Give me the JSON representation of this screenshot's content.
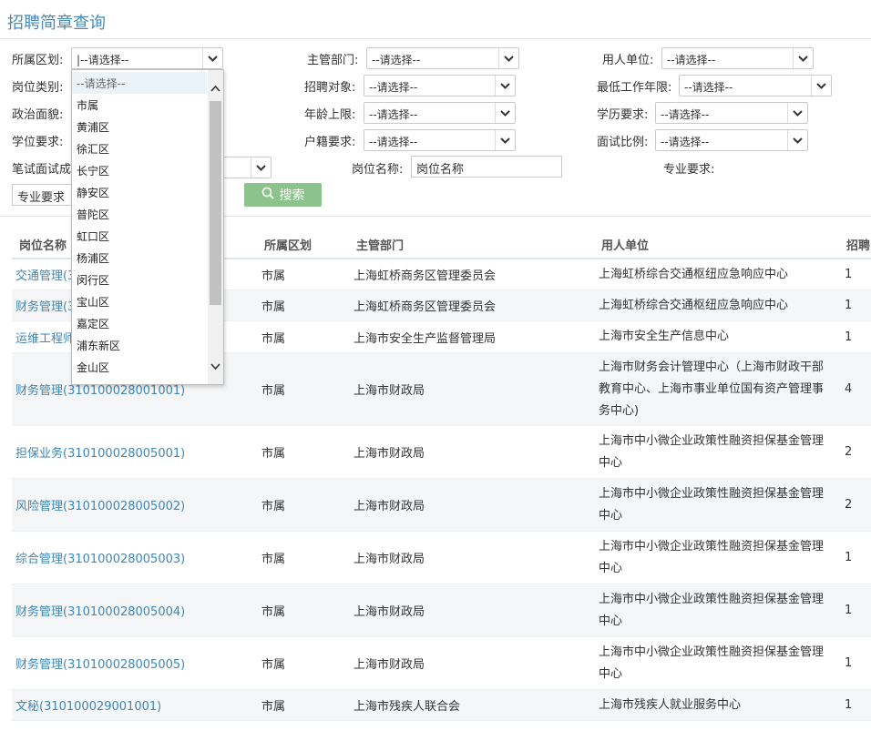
{
  "page": {
    "title": "招聘简章查询"
  },
  "filters": {
    "district": {
      "label": "所属区划:",
      "value": "|--请选择--"
    },
    "department": {
      "label": "主管部门:",
      "value": "--请选择--"
    },
    "employer": {
      "label": "用人单位:",
      "value": "--请选择--"
    },
    "position_type": {
      "label": "岗位类别:"
    },
    "recruit_target": {
      "label": "招聘对象:",
      "value": "--请选择--"
    },
    "min_work_years": {
      "label": "最低工作年限:",
      "value": "--请选择--"
    },
    "political": {
      "label": "政治面貌:"
    },
    "age_limit": {
      "label": "年龄上限:",
      "value": "--请选择--"
    },
    "education": {
      "label": "学历要求:",
      "value": "--请选择--"
    },
    "degree": {
      "label": "学位要求:"
    },
    "hukou": {
      "label": "户籍要求:",
      "value": "--请选择--"
    },
    "interview_ratio": {
      "label": "面试比例:",
      "value": "--请选择--"
    },
    "written_ratio": {
      "label": "笔试面试成"
    },
    "position_name": {
      "label": "岗位名称:",
      "placeholder": "岗位名称"
    },
    "major": {
      "label": "专业要求:",
      "placeholder": "专业要求"
    },
    "search_label": "搜索"
  },
  "district_dropdown": {
    "options": [
      "--请选择--",
      "市属",
      "黄浦区",
      "徐汇区",
      "长宁区",
      "静安区",
      "普陀区",
      "虹口区",
      "杨浦区",
      "闵行区",
      "宝山区",
      "嘉定区",
      "浦东新区",
      "金山区"
    ],
    "selected_index": 0
  },
  "table": {
    "columns": [
      "岗位名称",
      "所属区划",
      "主管部门",
      "用人单位",
      "招聘"
    ],
    "rows": [
      {
        "name": "交通管理(3",
        "district": "市属",
        "dept": "上海虹桥商务区管理委员会",
        "unit": "上海虹桥综合交通枢纽应急响应中心",
        "num": "1"
      },
      {
        "name": "财务管理(3",
        "district": "市属",
        "dept": "上海虹桥商务区管理委员会",
        "unit": "上海虹桥综合交通枢纽应急响应中心",
        "num": "1"
      },
      {
        "name": "运维工程师",
        "district": "市属",
        "dept": "上海市安全生产监督管理局",
        "unit": "上海市安全生产信息中心",
        "num": "1"
      },
      {
        "name": "财务管理(310100028001001)",
        "district": "市属",
        "dept": "上海市财政局",
        "unit": "上海市财务会计管理中心（上海市财政干部教育中心、上海市事业单位国有资产管理事务中心)",
        "num": "4"
      },
      {
        "name": "担保业务(310100028005001)",
        "district": "市属",
        "dept": "上海市财政局",
        "unit": "上海市中小微企业政策性融资担保基金管理中心",
        "num": "2"
      },
      {
        "name": "风险管理(310100028005002)",
        "district": "市属",
        "dept": "上海市财政局",
        "unit": "上海市中小微企业政策性融资担保基金管理中心",
        "num": "2"
      },
      {
        "name": "综合管理(310100028005003)",
        "district": "市属",
        "dept": "上海市财政局",
        "unit": "上海市中小微企业政策性融资担保基金管理中心",
        "num": "1"
      },
      {
        "name": "财务管理(310100028005004)",
        "district": "市属",
        "dept": "上海市财政局",
        "unit": "上海市中小微企业政策性融资担保基金管理中心",
        "num": "1"
      },
      {
        "name": "财务管理(310100028005005)",
        "district": "市属",
        "dept": "上海市财政局",
        "unit": "上海市中小微企业政策性融资担保基金管理中心",
        "num": "1"
      },
      {
        "name": "文秘(310100029001001)",
        "district": "市属",
        "dept": "上海市残疾人联合会",
        "unit": "上海市残疾人就业服务中心",
        "num": "1"
      }
    ]
  },
  "icons": {
    "select_arrow": "chevron-down-icon",
    "search": "search-icon",
    "scroll_up": "chevron-up-icon",
    "scroll_down": "chevron-down-icon"
  },
  "colors": {
    "title": "#4a8ab8",
    "link": "#3e86b5",
    "search_button": "#8cc28c"
  }
}
